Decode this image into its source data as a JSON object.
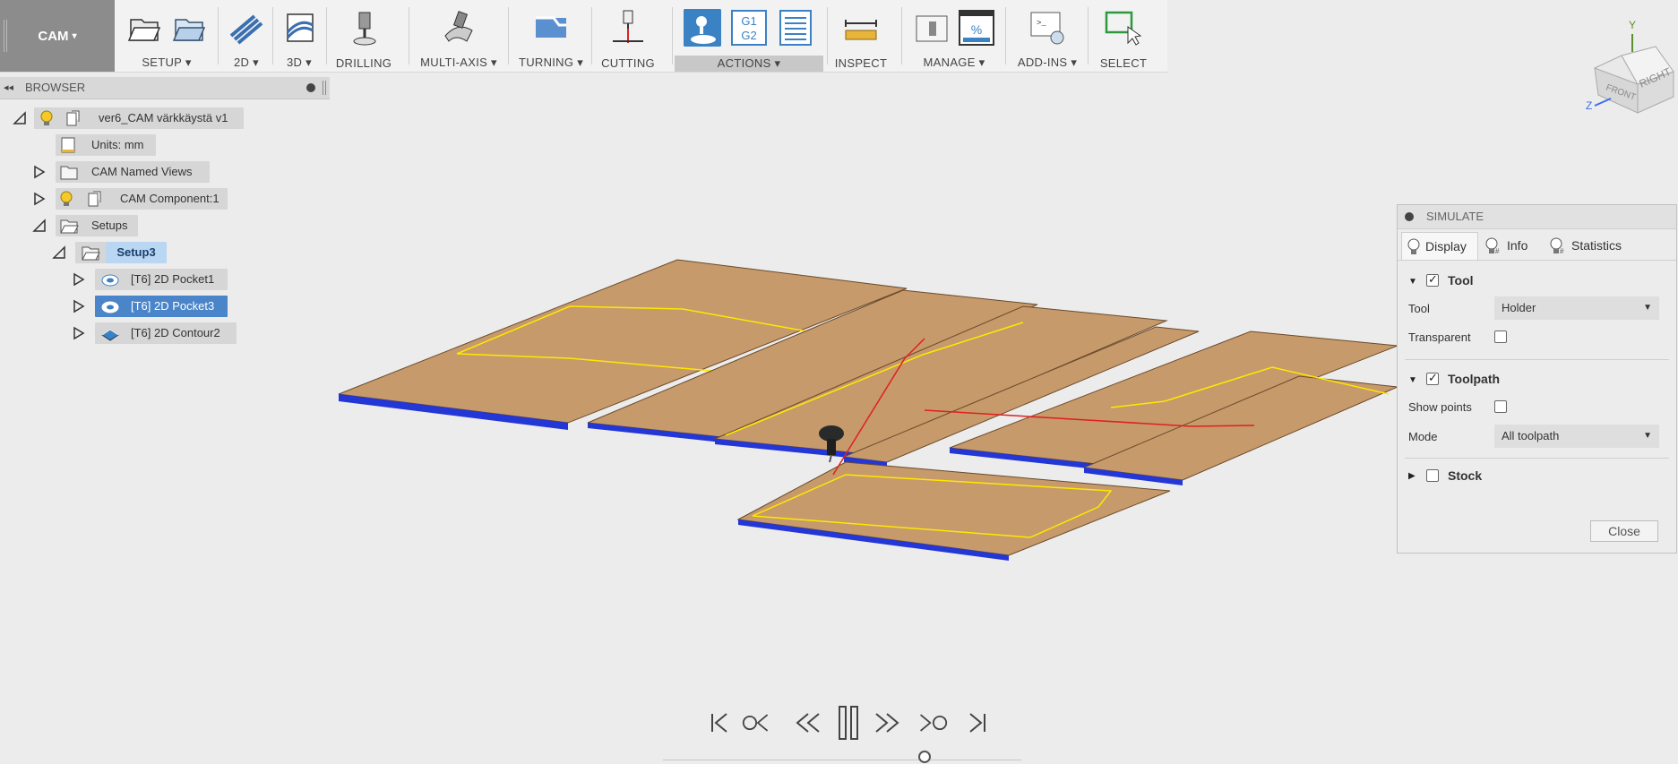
{
  "toolbar": {
    "workspace": "CAM",
    "groups": {
      "setup": "SETUP",
      "g2d": "2D",
      "g3d": "3D",
      "drilling": "DRILLING",
      "multiaxis": "MULTI-AXIS",
      "turning": "TURNING",
      "cutting": "CUTTING",
      "actions": "ACTIONS",
      "inspect": "INSPECT",
      "manage": "MANAGE",
      "addins": "ADD-INS",
      "select": "SELECT"
    },
    "caret": "▾",
    "g1g2_icon_text": [
      "G1",
      "G2"
    ]
  },
  "browser": {
    "title": "BROWSER",
    "root": "ver6_CAM värkkäystä v1",
    "units": "Units: mm",
    "named_views": "CAM Named Views",
    "component": "CAM Component:1",
    "setups": "Setups",
    "setup": "Setup3",
    "operations": [
      "[T6] 2D Pocket1",
      "[T6] 2D Pocket3",
      "[T6] 2D Contour2"
    ]
  },
  "viewcube": {
    "faces": [
      "FRONT",
      "RIGHT"
    ],
    "axes": [
      "Y",
      "Z"
    ]
  },
  "simulate": {
    "title": "SIMULATE",
    "tabs": [
      "Display",
      "Info",
      "Statistics"
    ],
    "tool_section": "Tool",
    "tool_label": "Tool",
    "tool_value": "Holder",
    "transparent_label": "Transparent",
    "toolpath_section": "Toolpath",
    "show_points_label": "Show points",
    "mode_label": "Mode",
    "mode_value": "All toolpath",
    "stock_section": "Stock",
    "close": "Close",
    "tool_checked": true,
    "toolpath_checked": true,
    "transparent_checked": false,
    "show_points_checked": false,
    "stock_checked": false
  },
  "playback": {
    "position": 0.73
  },
  "colors": {
    "board": "#c69a6b",
    "board_edge": "#2336d6",
    "toolpath": "#ffe800",
    "rapid": "#e02020",
    "selected": "#4a84c9"
  }
}
